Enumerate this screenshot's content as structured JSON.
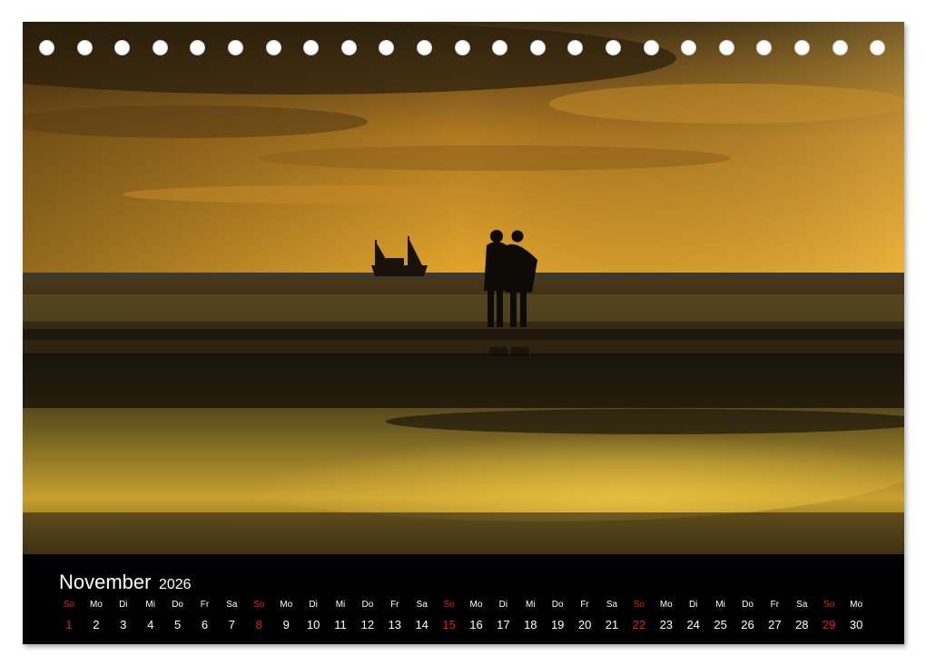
{
  "calendar": {
    "month": "November",
    "year": "2026",
    "sunday_color": "#e02020",
    "days": [
      {
        "name": "So",
        "num": "1",
        "sunday": true
      },
      {
        "name": "Mo",
        "num": "2"
      },
      {
        "name": "Di",
        "num": "3"
      },
      {
        "name": "Mi",
        "num": "4"
      },
      {
        "name": "Do",
        "num": "5"
      },
      {
        "name": "Fr",
        "num": "6"
      },
      {
        "name": "Sa",
        "num": "7"
      },
      {
        "name": "So",
        "num": "8",
        "sunday": true
      },
      {
        "name": "Mo",
        "num": "9"
      },
      {
        "name": "Di",
        "num": "10"
      },
      {
        "name": "Mi",
        "num": "11"
      },
      {
        "name": "Do",
        "num": "12"
      },
      {
        "name": "Fr",
        "num": "13"
      },
      {
        "name": "Sa",
        "num": "14"
      },
      {
        "name": "So",
        "num": "15",
        "sunday": true
      },
      {
        "name": "Mo",
        "num": "16"
      },
      {
        "name": "Di",
        "num": "17"
      },
      {
        "name": "Mi",
        "num": "18"
      },
      {
        "name": "Do",
        "num": "19"
      },
      {
        "name": "Fr",
        "num": "20"
      },
      {
        "name": "Sa",
        "num": "21"
      },
      {
        "name": "So",
        "num": "22",
        "sunday": true
      },
      {
        "name": "Mo",
        "num": "23"
      },
      {
        "name": "Di",
        "num": "24"
      },
      {
        "name": "Mi",
        "num": "25"
      },
      {
        "name": "Do",
        "num": "26"
      },
      {
        "name": "Fr",
        "num": "27"
      },
      {
        "name": "Sa",
        "num": "28"
      },
      {
        "name": "So",
        "num": "29",
        "sunday": true
      },
      {
        "name": "Mo",
        "num": "30"
      }
    ]
  },
  "photo": {
    "subject": "sunset-beach-couple-silhouette",
    "sky_color": "#d9a22c",
    "water_color": "#c89a2a"
  },
  "binding": {
    "hole_count": 23
  }
}
